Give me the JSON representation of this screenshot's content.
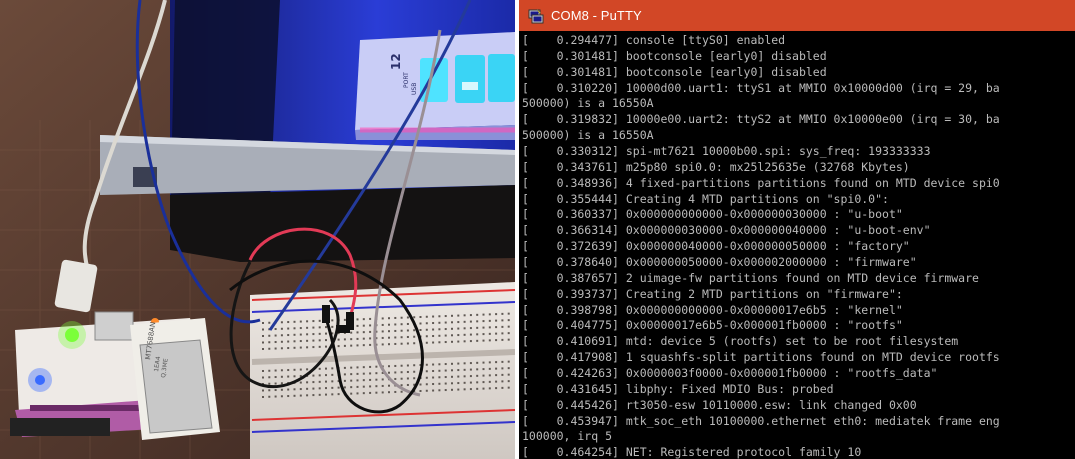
{
  "window": {
    "title": "COM8 - PuTTY",
    "title_bar_color": "#d24726",
    "background": "#000000",
    "text_color": "#bbbbbb"
  },
  "app_icon": "putty-icon",
  "photo": {
    "hub_label_top": "12",
    "hub_label_mid": "PORT",
    "hub_label_bottom": "USB",
    "module_label_1": "MT7688AN",
    "module_label_2": "1EA4",
    "module_label_3": "Q.3ME"
  },
  "terminal": {
    "lines": [
      "[    0.294477] console [ttyS0] enabled",
      "[    0.301481] bootconsole [early0] disabled",
      "[    0.301481] bootconsole [early0] disabled",
      "[    0.310220] 10000d00.uart1: ttyS1 at MMIO 0x10000d00 (irq = 29, ba",
      "500000) is a 16550A",
      "[    0.319832] 10000e00.uart2: ttyS2 at MMIO 0x10000e00 (irq = 30, ba",
      "500000) is a 16550A",
      "[    0.330312] spi-mt7621 10000b00.spi: sys_freq: 193333333",
      "[    0.343761] m25p80 spi0.0: mx25l25635e (32768 Kbytes)",
      "[    0.348936] 4 fixed-partitions partitions found on MTD device spi0",
      "[    0.355444] Creating 4 MTD partitions on \"spi0.0\":",
      "[    0.360337] 0x000000000000-0x000000030000 : \"u-boot\"",
      "[    0.366314] 0x000000030000-0x000000040000 : \"u-boot-env\"",
      "[    0.372639] 0x000000040000-0x000000050000 : \"factory\"",
      "[    0.378640] 0x000000050000-0x000002000000 : \"firmware\"",
      "[    0.387657] 2 uimage-fw partitions found on MTD device firmware",
      "[    0.393737] Creating 2 MTD partitions on \"firmware\":",
      "[    0.398798] 0x000000000000-0x00000017e6b5 : \"kernel\"",
      "[    0.404775] 0x00000017e6b5-0x000001fb0000 : \"rootfs\"",
      "[    0.410691] mtd: device 5 (rootfs) set to be root filesystem",
      "[    0.417908] 1 squashfs-split partitions found on MTD device rootfs",
      "[    0.424263] 0x0000003f0000-0x000001fb0000 : \"rootfs_data\"",
      "[    0.431645] libphy: Fixed MDIO Bus: probed",
      "[    0.445426] rt3050-esw 10110000.esw: link changed 0x00",
      "[    0.453947] mtk_soc_eth 10100000.ethernet eth0: mediatek frame eng",
      "100000, irq 5",
      "[    0.464254] NET: Registered protocol family 10"
    ]
  }
}
